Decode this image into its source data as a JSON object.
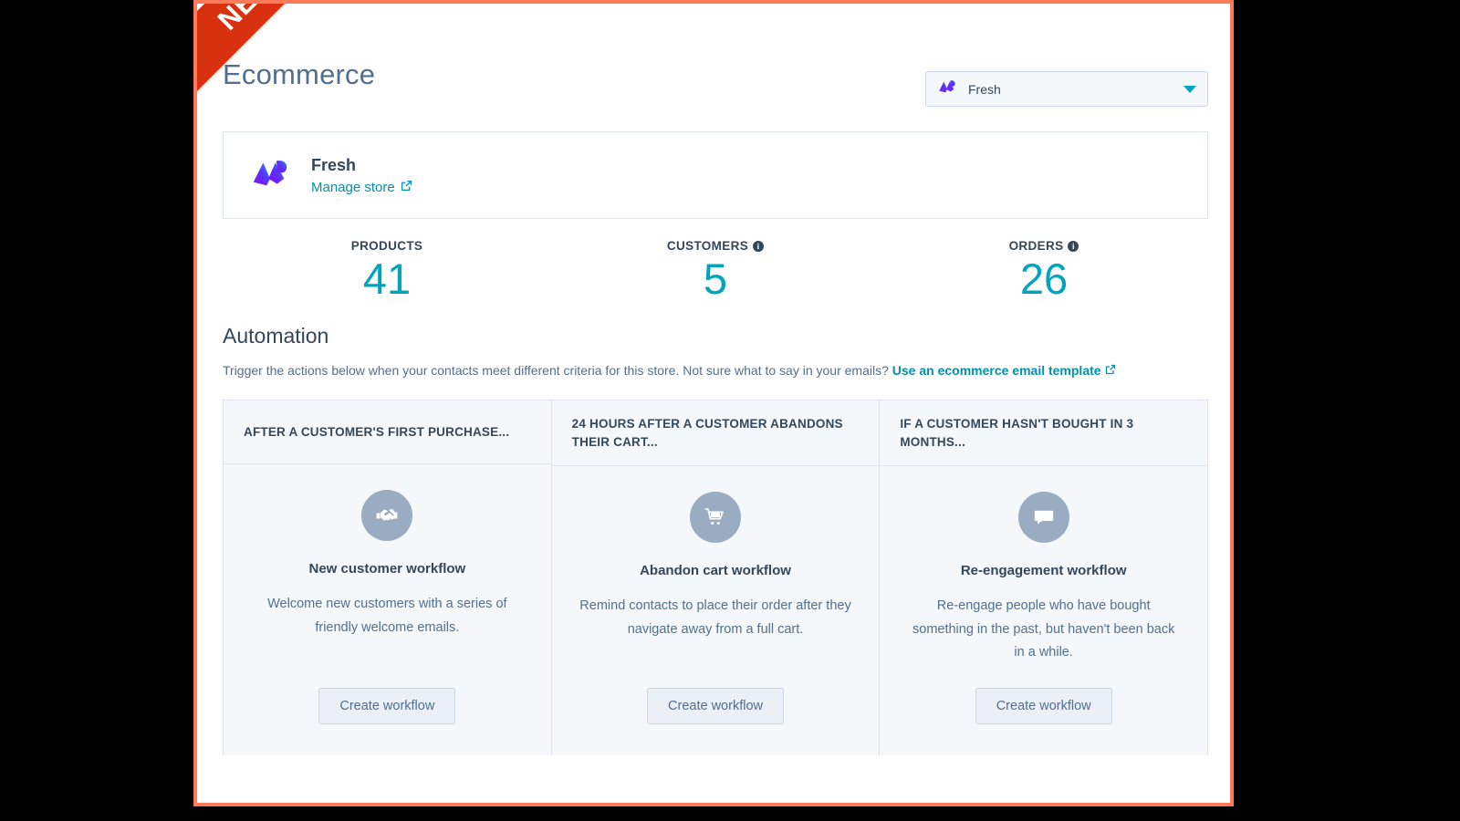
{
  "ribbon": {
    "label": "NEW"
  },
  "header": {
    "title": "Ecommerce",
    "store_select": {
      "value": "Fresh",
      "icon": "brand-logo-icon",
      "caret_icon": "chevron-down-icon"
    }
  },
  "store_card": {
    "logo_icon": "brand-logo-icon",
    "name": "Fresh",
    "manage_link": "Manage store",
    "external_icon": "external-link-icon"
  },
  "stats": [
    {
      "label": "PRODUCTS",
      "value": "41",
      "has_info": false
    },
    {
      "label": "CUSTOMERS",
      "value": "5",
      "has_info": true
    },
    {
      "label": "ORDERS",
      "value": "26",
      "has_info": true
    }
  ],
  "automation": {
    "title": "Automation",
    "description_prefix": "Trigger the actions below when your contacts meet different criteria for this store. Not sure what to say in your emails? ",
    "description_link": "Use an ecommerce email template",
    "external_icon": "external-link-icon"
  },
  "workflows": [
    {
      "header": "AFTER A CUSTOMER'S FIRST PURCHASE...",
      "icon": "handshake-icon",
      "name": "New customer workflow",
      "description": "Welcome new customers with a series of friendly welcome emails.",
      "button": "Create workflow"
    },
    {
      "header": "24 HOURS AFTER A CUSTOMER ABANDONS THEIR CART...",
      "icon": "shopping-cart-icon",
      "name": "Abandon cart workflow",
      "description": "Remind contacts to place their order after they navigate away from a full cart.",
      "button": "Create workflow"
    },
    {
      "header": "IF A CUSTOMER HASN'T BOUGHT IN 3 MONTHS...",
      "icon": "chat-bubble-icon",
      "name": "Re-engagement workflow",
      "description": "Re-engage people who have bought something in the past, but haven't been back in a while.",
      "button": "Create workflow"
    }
  ],
  "colors": {
    "accent_teal": "#00a4bd",
    "link_blue": "#0091ae",
    "text_dark": "#33475b",
    "text_muted": "#516f90",
    "ribbon_red": "#d8310f",
    "frame_coral": "#ff7a59",
    "icon_circle": "#99acc2"
  }
}
